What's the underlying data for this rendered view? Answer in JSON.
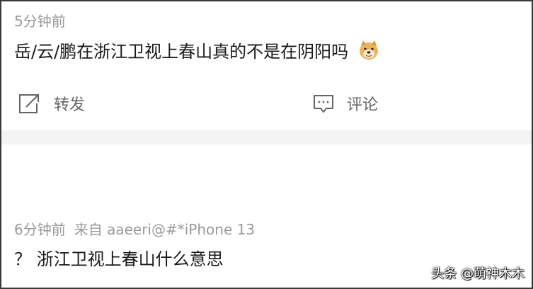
{
  "post": {
    "time": "5分钟前",
    "text": "岳/云/鹏在浙江卫视上春山真的不是在阴阳吗",
    "emoji": "doge-emoji",
    "actions": {
      "forward_label": "转发",
      "forward_icon": "share-icon",
      "comment_label": "评论",
      "comment_icon": "comment-icon"
    }
  },
  "reply": {
    "time": "6分钟前",
    "source": "来自 aaeeri@#*iPhone 13",
    "text": "？ 浙江卫视上春山什么意思"
  },
  "watermark": "头条 @萌神木木",
  "colors": {
    "meta_text": "#9a9a9a",
    "body_text": "#1a1a1a",
    "action_text": "#666666",
    "divider": "#f4f4f4"
  }
}
